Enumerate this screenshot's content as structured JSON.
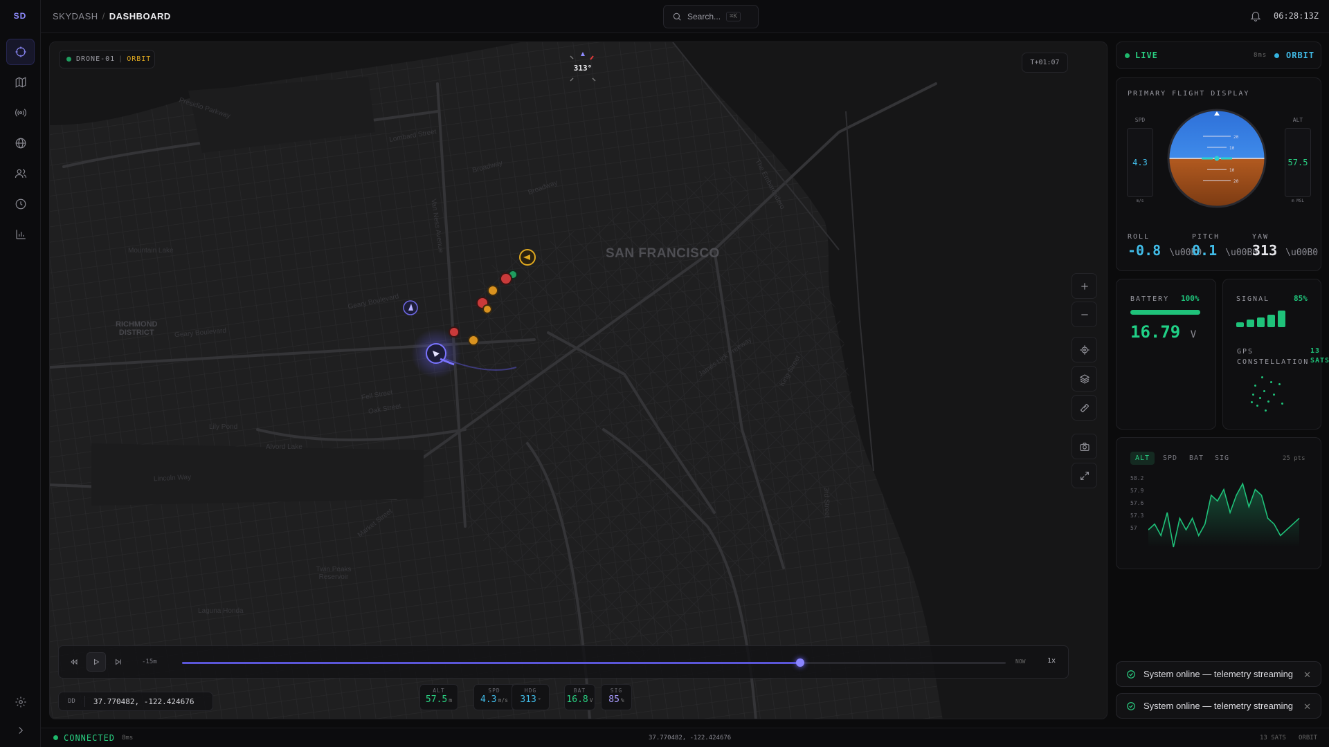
{
  "app": {
    "logo": "SD",
    "breadcrumb_root": "SKYDASH",
    "breadcrumb_current": "DASHBOARD"
  },
  "search": {
    "placeholder": "Search...",
    "shortcut": "⌘K"
  },
  "clock": "06:28:13Z",
  "sidebar": {
    "items": [
      {
        "icon": "crosshair-icon",
        "active": true
      },
      {
        "icon": "map-icon"
      },
      {
        "icon": "broadcast-icon"
      },
      {
        "icon": "globe-icon"
      },
      {
        "icon": "users-icon"
      },
      {
        "icon": "clock-icon"
      },
      {
        "icon": "bar-chart-icon"
      }
    ],
    "bottom": [
      {
        "icon": "settings-icon"
      },
      {
        "icon": "expand-icon"
      }
    ]
  },
  "map": {
    "drone_name": "DRONE-01",
    "drone_mode": "ORBIT",
    "mission_time": "T+01:07",
    "heading": "313°",
    "labels": {
      "city": "SAN FRANCISCO",
      "district": "RICHMOND\nDISTRICT",
      "streets": [
        "Presidio Parkway",
        "Lombard Street",
        "Broadway",
        "Van Ness Avenue",
        "Geary Boulevard",
        "Fell Street",
        "Oak Street",
        "Lincoln Way",
        "Market Street",
        "Mountain Lake",
        "Lily Pond",
        "Alvord Lake",
        "Twin Peaks Reservoir",
        "Laguna Honda",
        "The Embarcadero",
        "King Street",
        "3rd Street",
        "James Lick Freeway"
      ]
    },
    "playback": {
      "back_label": "-15m",
      "progress_pct": 75,
      "now_label": "NOW",
      "speed": "1x"
    },
    "coords": {
      "format": "DD",
      "value": "37.770482, -122.424676"
    },
    "telemetry": [
      {
        "key": "ALT",
        "value": "57.5",
        "unit": "m",
        "color": "#2ad283"
      },
      {
        "key": "SPD",
        "value": "4.3",
        "unit": "m/s",
        "color": "#41bce8"
      },
      {
        "key": "HDG",
        "value": "313",
        "unit": "°",
        "color": "#41bce8"
      },
      {
        "key": "BAT",
        "value": "16.8",
        "unit": "V",
        "color": "#2ad283"
      },
      {
        "key": "SIG",
        "value": "85",
        "unit": "%",
        "color": "#a89cff"
      }
    ]
  },
  "panel": {
    "status": {
      "live": "LIVE",
      "latency": "8ms",
      "mode": "ORBIT"
    },
    "pfd": {
      "title": "PRIMARY FLIGHT DISPLAY",
      "spd_label": "SPD",
      "spd_value": "4.3",
      "spd_unit": "m/s",
      "alt_label": "ALT",
      "alt_value": "57.5",
      "alt_unit": "m MSL",
      "roll_label": "ROLL",
      "roll_value": "-0.8",
      "roll_unit": "\\u00B0",
      "pitch_label": "PITCH",
      "pitch_value": "0.1",
      "pitch_unit": "\\u00B0",
      "yaw_label": "YAW",
      "yaw_value": "313",
      "yaw_unit": "\\u00B0",
      "ladder": [
        "20",
        "10",
        "10",
        "20"
      ]
    },
    "battery": {
      "label": "BATTERY",
      "pct": "100%",
      "level": 1.0,
      "voltage": "16.79",
      "unit": "V"
    },
    "signal": {
      "label": "SIGNAL",
      "pct": "85%",
      "bars": [
        0.3,
        0.45,
        0.6,
        0.75,
        1.0
      ]
    },
    "gps": {
      "label": "GPS CONSTELLATION",
      "count": "13 SATS"
    },
    "chart": {
      "tabs": [
        "ALT",
        "SPD",
        "BAT",
        "SIG"
      ],
      "active_tab": "ALT",
      "points_label": "25 pts",
      "y_ticks": [
        "58.2",
        "57.9",
        "57.6",
        "57.3",
        "57"
      ]
    }
  },
  "chart_data": {
    "type": "area",
    "series": [
      {
        "values": [
          57.3,
          57.4,
          57.2,
          57.6,
          57.0,
          57.5,
          57.3,
          57.5,
          57.2,
          57.4,
          57.9,
          57.8,
          58.0,
          57.6,
          57.9,
          58.1,
          57.7,
          58.0,
          57.9,
          57.5,
          57.4,
          57.2,
          57.3,
          57.4,
          57.5
        ]
      }
    ],
    "ylim": [
      57,
      58.2
    ]
  },
  "toasts": [
    {
      "text": "System online — telemetry streaming"
    },
    {
      "text": "System online — telemetry streaming"
    }
  ],
  "statusbar": {
    "connection": "CONNECTED",
    "latency": "8ms",
    "coords": "37.770482, -122.424676",
    "sats": "13 SATS",
    "mode": "ORBIT"
  }
}
